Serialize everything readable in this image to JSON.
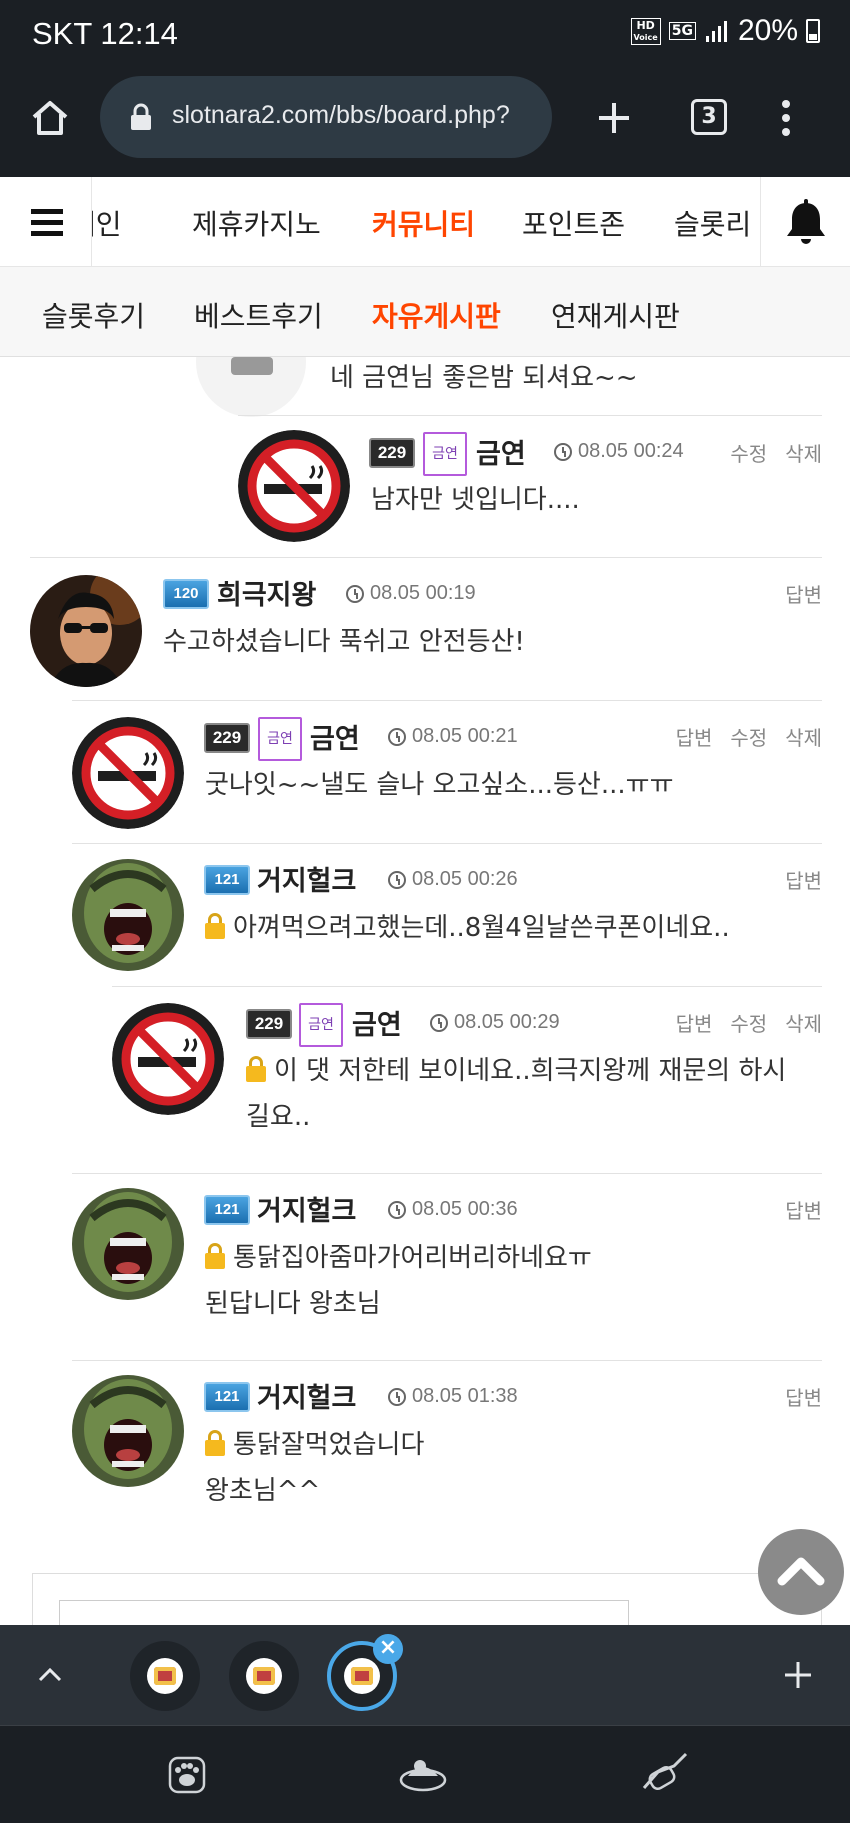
{
  "status_bar": {
    "carrier_time": "SKT 12:14",
    "hd_label": "HD",
    "voice_label": "Voice",
    "network": "5G",
    "battery": "20%"
  },
  "browser": {
    "url": "slotnara2.com/bbs/board.php?",
    "tab_count": "3"
  },
  "nav": {
    "items": [
      "메인",
      "제휴카지노",
      "커뮤니티",
      "포인트존",
      "슬롯리"
    ],
    "active": "커뮤니티"
  },
  "subnav": {
    "items": [
      "슬롯후기",
      "베스트후기",
      "자유게시판",
      "연재게시판"
    ],
    "active": "자유게시판"
  },
  "comments": [
    {
      "text": "네 금연님 좋은밤 되셔요~~"
    },
    {
      "level": "229",
      "badge": "금연",
      "nick": "금연",
      "date": "08.05 00:24",
      "actions": [
        "수정",
        "삭제"
      ],
      "text": "남자만 넷입니다...."
    },
    {
      "level": "120",
      "nick": "희극지왕",
      "date": "08.05 00:19",
      "actions": [
        "답변"
      ],
      "text": "수고하셨습니다  푹쉬고 안전등산!"
    },
    {
      "level": "229",
      "badge": "금연",
      "nick": "금연",
      "date": "08.05 00:21",
      "actions": [
        "답변",
        "수정",
        "삭제"
      ],
      "text": "굿나잇~~낼도 슬나 오고싶소...등산...ㅠㅠ"
    },
    {
      "level": "121",
      "nick": "거지헐크",
      "date": "08.05 00:26",
      "actions": [
        "답변"
      ],
      "text": "아껴먹으려고했는데..8월4일날쓴쿠폰이네요.."
    },
    {
      "level": "229",
      "badge": "금연",
      "nick": "금연",
      "date": "08.05 00:29",
      "actions": [
        "답변",
        "수정",
        "삭제"
      ],
      "text1": "이 댓 저한테 보이네요..희극지왕께 재문의 하시",
      "text2": "길요.."
    },
    {
      "level": "121",
      "nick": "거지헐크",
      "date": "08.05 00:36",
      "actions": [
        "답변"
      ],
      "text1": "통닭집아줌마가어리버리하네요ㅠ",
      "text2": "된답니다 왕초님"
    },
    {
      "level": "121",
      "nick": "거지헐크",
      "date": "08.05 01:38",
      "actions": [
        "답변"
      ],
      "text1": "통닭잘먹었습니다",
      "text2": "왕초님^^"
    }
  ],
  "icons": {
    "home": "home-icon",
    "lock": "lock-icon",
    "new_tab": "plus-icon",
    "menu": "kebab-menu-icon",
    "bell": "bell-icon",
    "no_smoking": "no-smoking-avatar"
  },
  "colors": {
    "accent": "#ff4500",
    "dark_bar": "#1b1f24",
    "tab_active": "#4aa8e8"
  }
}
